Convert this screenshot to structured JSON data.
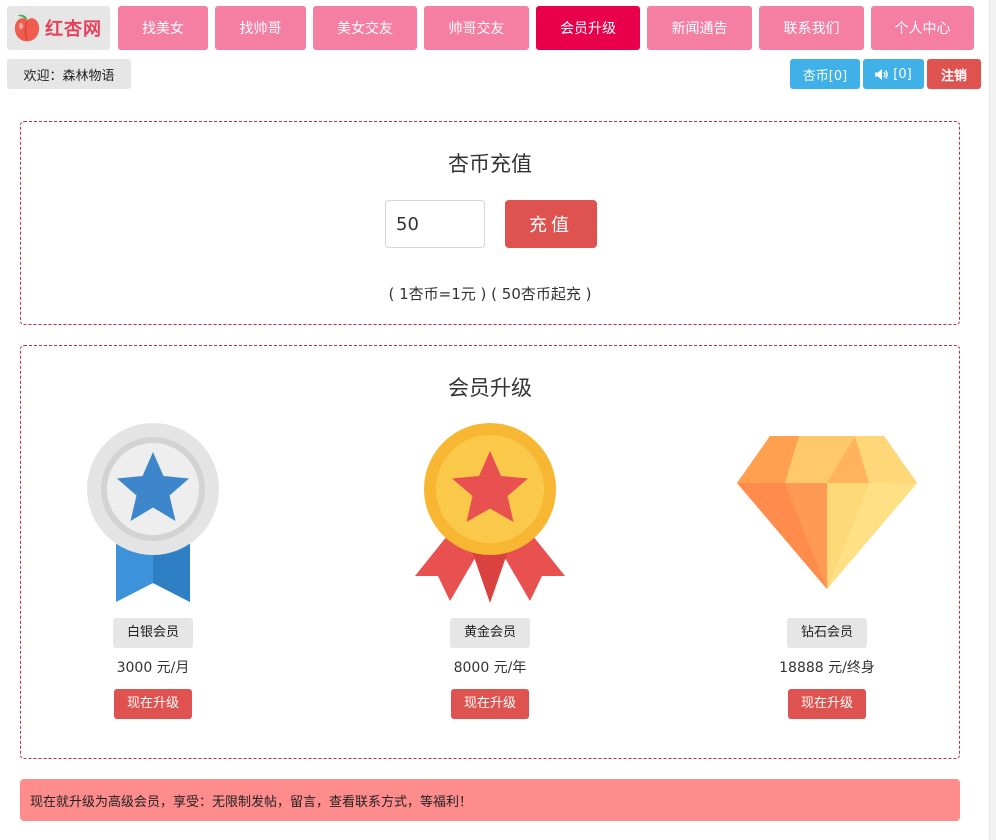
{
  "logo": {
    "text": "红杏网"
  },
  "nav": {
    "items": [
      {
        "label": "找美女",
        "active": false
      },
      {
        "label": "找帅哥",
        "active": false
      },
      {
        "label": "美女交友",
        "active": false
      },
      {
        "label": "帅哥交友",
        "active": false
      },
      {
        "label": "会员升级",
        "active": true
      },
      {
        "label": "新闻通告",
        "active": false
      },
      {
        "label": "联系我们",
        "active": false
      },
      {
        "label": "个人中心",
        "active": false
      }
    ]
  },
  "user": {
    "welcome": "欢迎：森林物语"
  },
  "toolbar": {
    "coins_label": "杏币[0]",
    "notify_label": "[0]",
    "logout_label": "注销"
  },
  "recharge": {
    "title": "杏币充值",
    "amount": "50",
    "button_label": "充值",
    "note": "( 1杏币=1元 ) ( 50杏币起充 )"
  },
  "membership": {
    "title": "会员升级",
    "tiers": [
      {
        "name": "白银会员",
        "price": "3000 元/月",
        "button": "现在升级"
      },
      {
        "name": "黄金会员",
        "price": "8000 元/年",
        "button": "现在升级"
      },
      {
        "name": "钻石会员",
        "price": "18888 元/终身",
        "button": "现在升级"
      }
    ]
  },
  "banner": {
    "text": "现在就升级为高级会员，享受：无限制发帖，留言，查看联系方式，等福利！"
  },
  "colors": {
    "nav_pink": "#f57fa3",
    "nav_active": "#e8004c",
    "button_red": "#de524f",
    "button_blue": "#3fb0e8",
    "banner_bg": "#ff8c8c"
  },
  "icons": [
    "peach-logo-icon",
    "speaker-icon",
    "silver-medal-icon",
    "gold-medal-icon",
    "diamond-icon"
  ]
}
